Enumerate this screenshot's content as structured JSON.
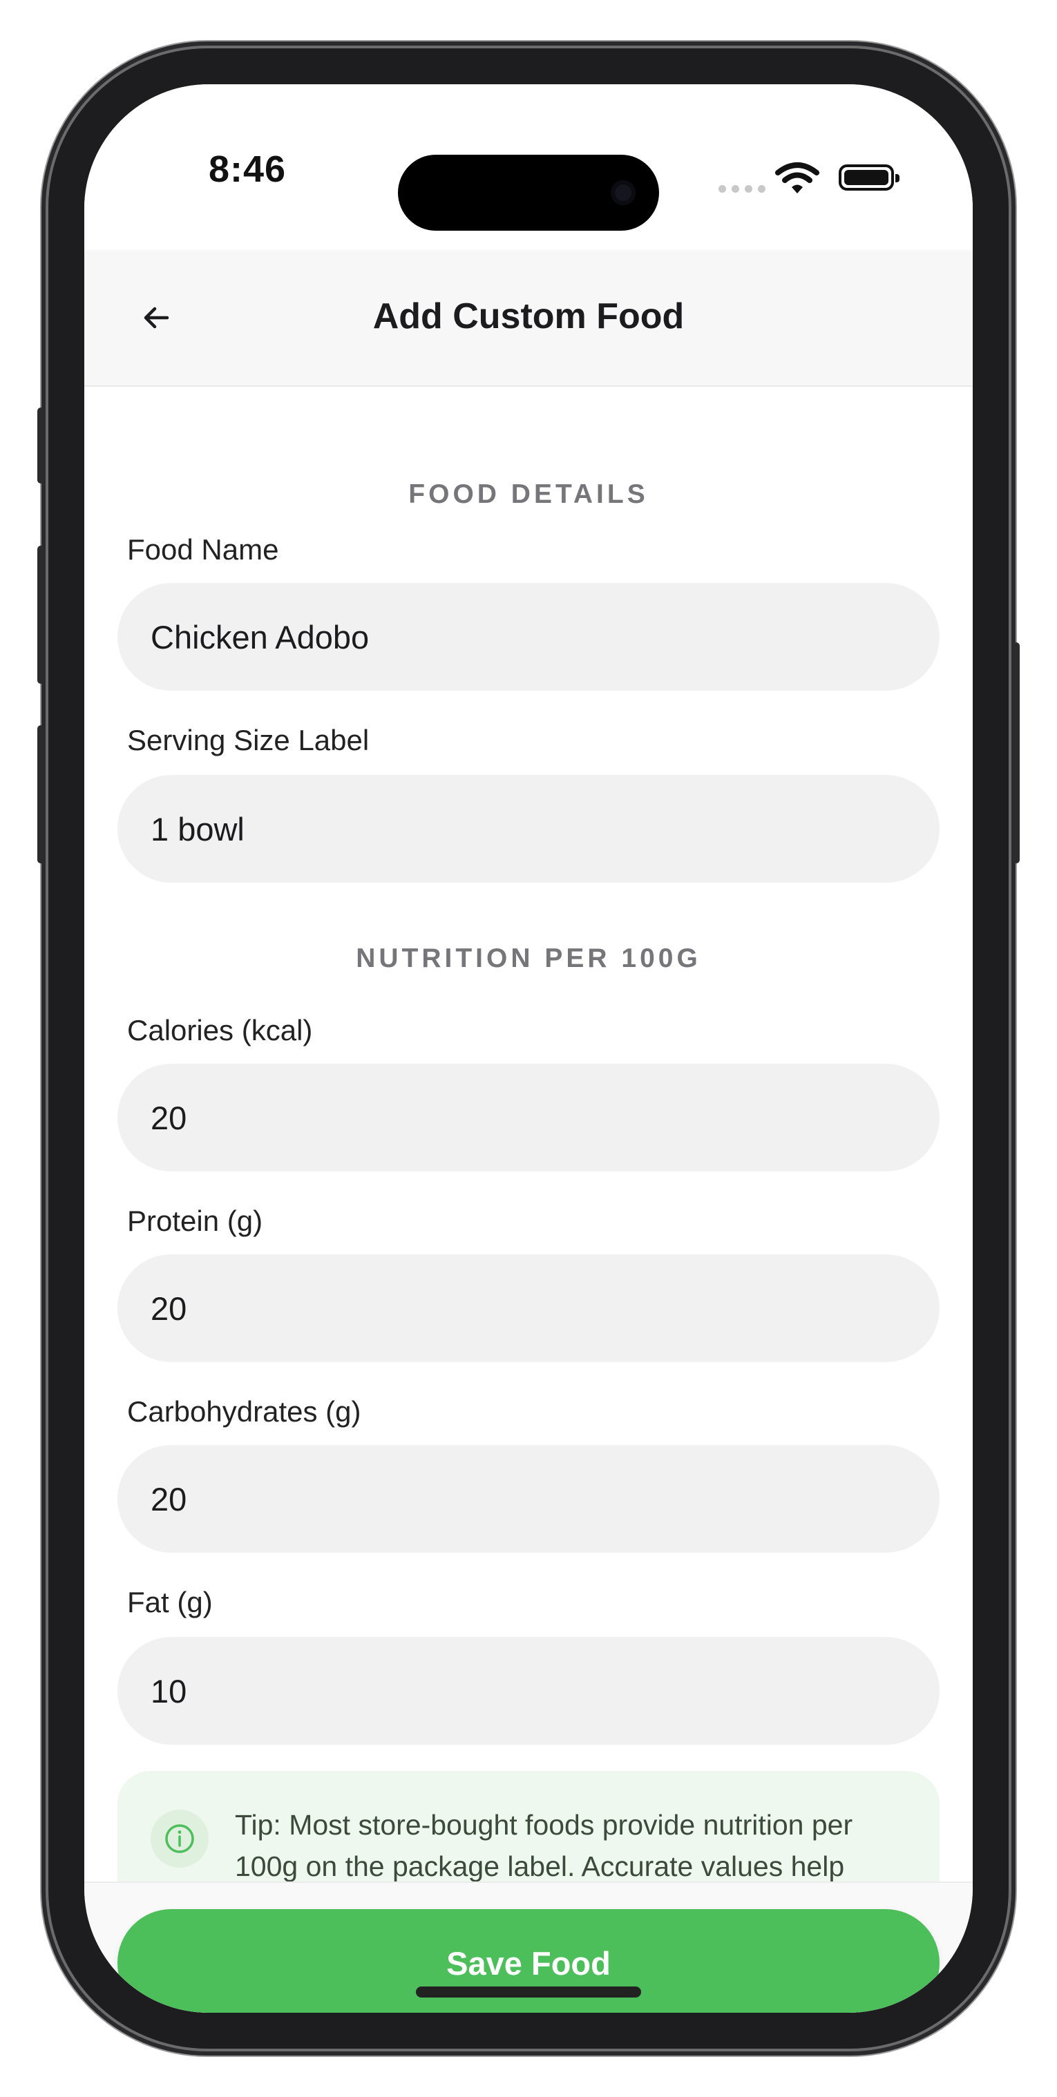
{
  "status_bar": {
    "time": "8:46"
  },
  "header": {
    "title": "Add Custom Food"
  },
  "sections": {
    "details": "FOOD DETAILS",
    "nutrition": "NUTRITION PER 100G"
  },
  "fields": {
    "food_name": {
      "label": "Food Name",
      "value": "Chicken Adobo"
    },
    "serving": {
      "label": "Serving Size Label",
      "value": "1 bowl"
    },
    "calories": {
      "label": "Calories (kcal)",
      "value": "20"
    },
    "protein": {
      "label": "Protein (g)",
      "value": "20"
    },
    "carbs": {
      "label": "Carbohydrates (g)",
      "value": "20"
    },
    "fat": {
      "label": "Fat (g)",
      "value": "10"
    }
  },
  "tip": {
    "text": "Tip: Most store-bought foods provide nutrition per 100g on the package label. Accurate values help"
  },
  "footer": {
    "save_label": "Save Food"
  },
  "colors": {
    "accent": "#4cbe5a",
    "tip_bg": "#eef8ee"
  },
  "icons": {
    "back": "arrow-left-icon",
    "info": "info-icon",
    "wifi": "wifi-icon",
    "battery": "battery-icon"
  }
}
